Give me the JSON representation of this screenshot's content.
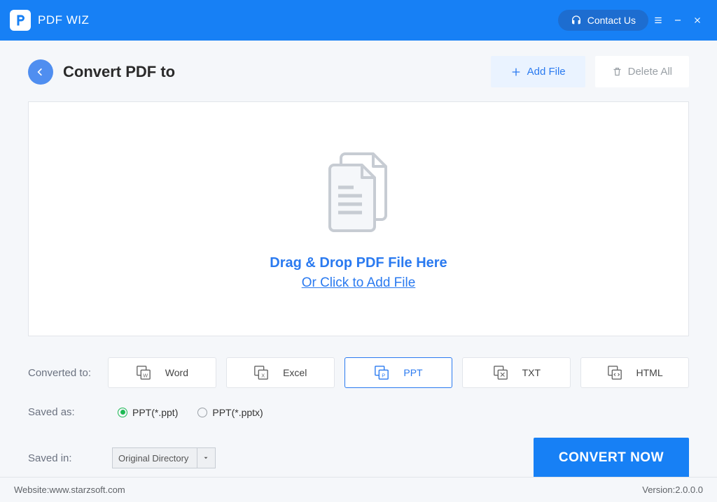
{
  "app": {
    "title": "PDF WIZ"
  },
  "titlebar": {
    "contact": "Contact Us"
  },
  "header": {
    "page_title": "Convert PDF to",
    "add_file": "Add File",
    "delete_all": "Delete All"
  },
  "dropzone": {
    "line1": "Drag & Drop PDF File Here",
    "line2": "Or Click to Add File"
  },
  "formats": {
    "label": "Converted to:",
    "items": [
      "Word",
      "Excel",
      "PPT",
      "TXT",
      "HTML"
    ],
    "selected": "PPT"
  },
  "saveas": {
    "label": "Saved as:",
    "options": [
      "PPT(*.ppt)",
      "PPT(*.pptx)"
    ],
    "selected": "PPT(*.ppt)"
  },
  "savedin": {
    "label": "Saved in:",
    "value": "Original Directory"
  },
  "convert_label": "CONVERT NOW",
  "footer": {
    "website_label": "Website: ",
    "website": "www.starzsoft.com",
    "version_label": "Version: ",
    "version": "2.0.0.0"
  }
}
